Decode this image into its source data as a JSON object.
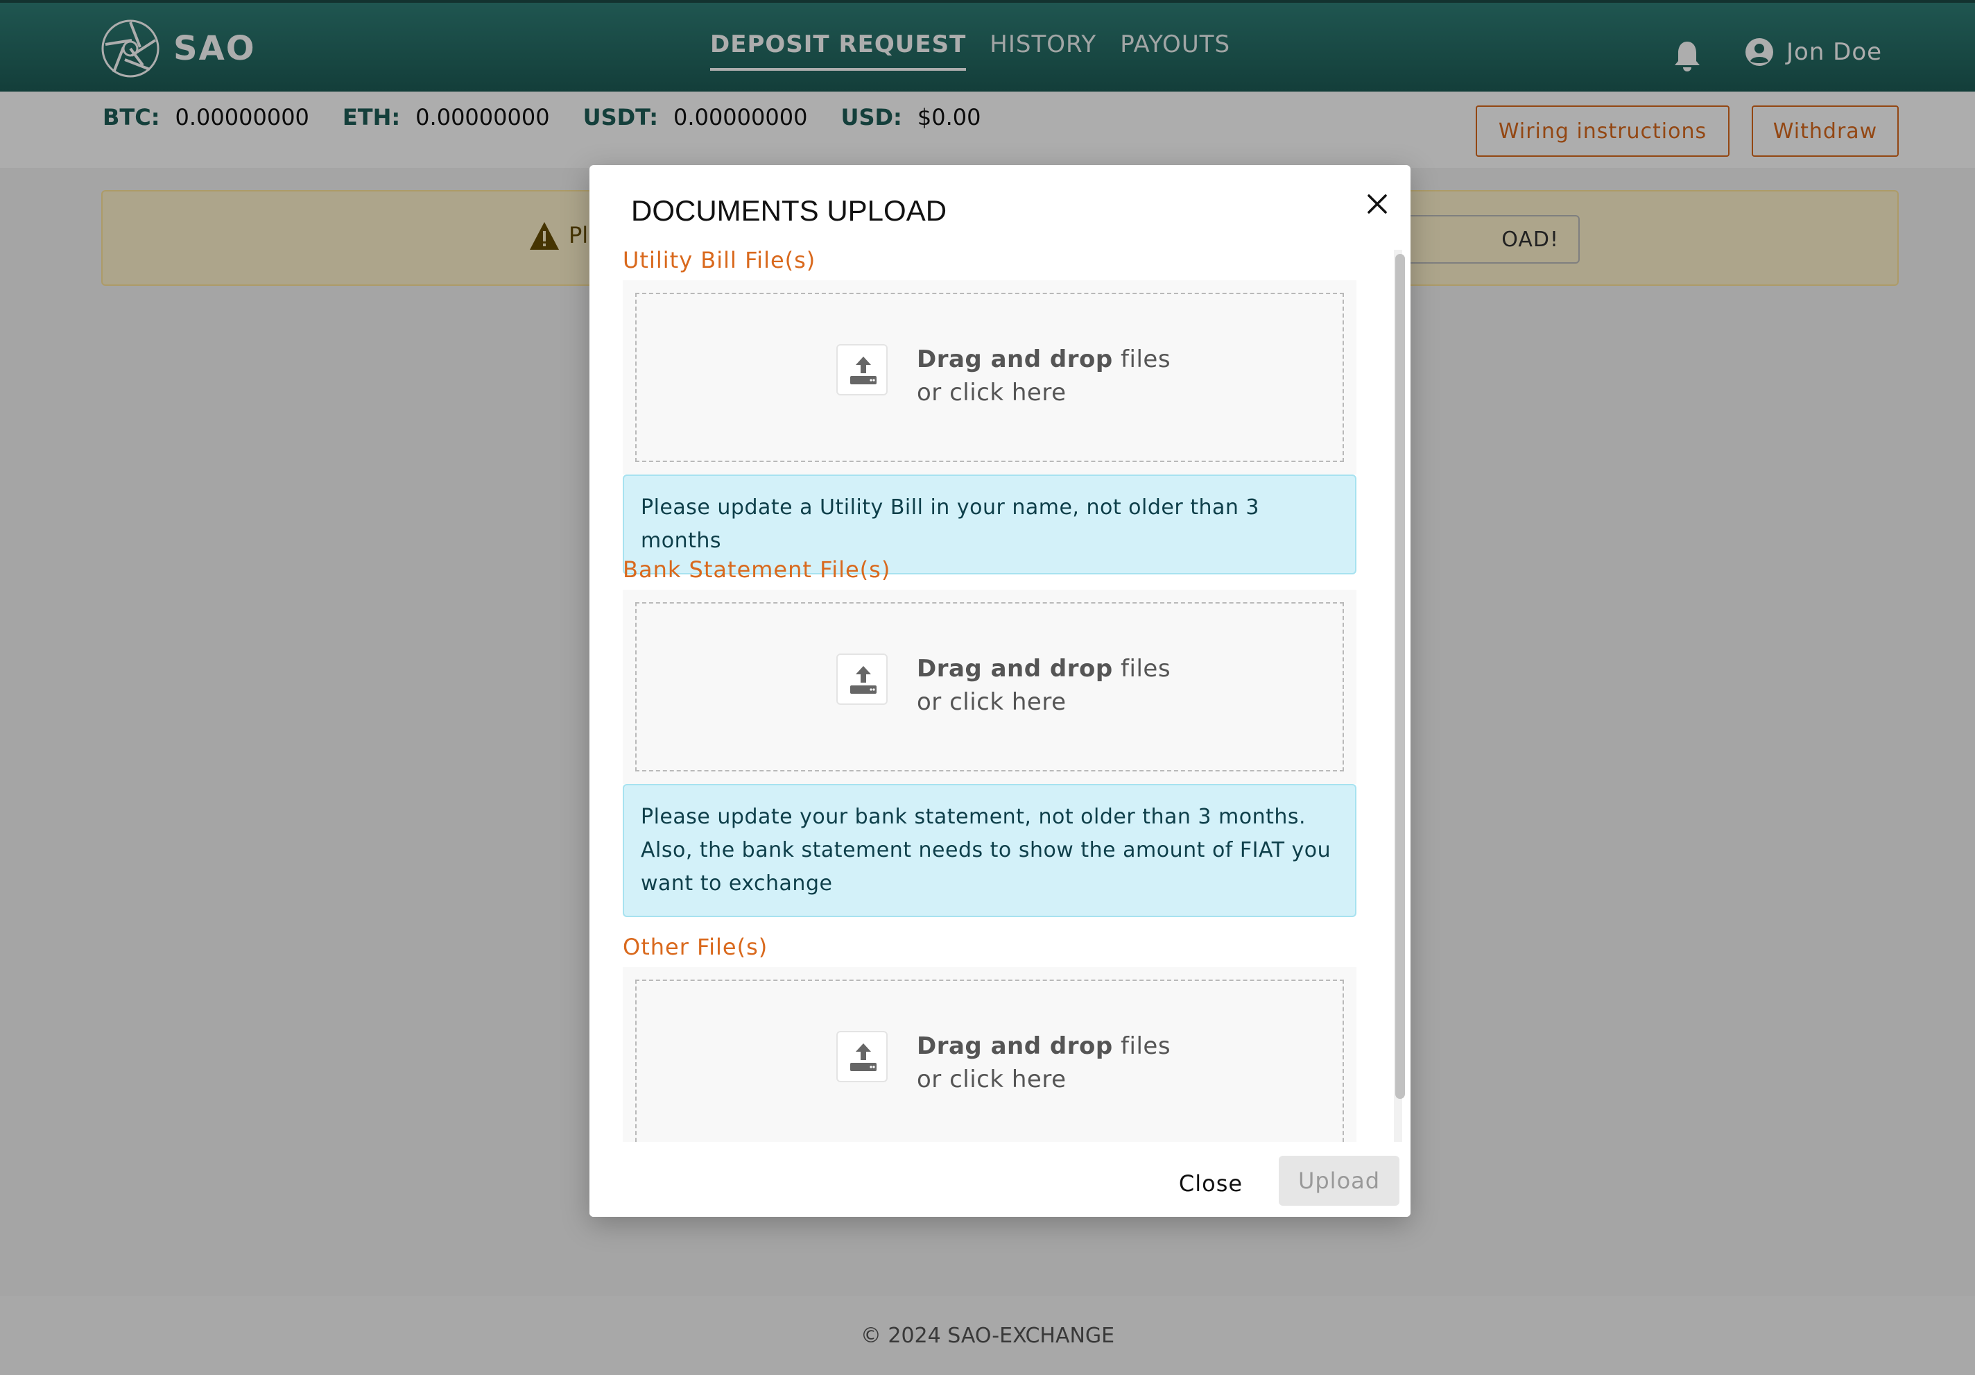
{
  "header": {
    "brand": "SAO",
    "nav": [
      {
        "label": "DEPOSIT REQUEST",
        "active": true
      },
      {
        "label": "HISTORY",
        "active": false
      },
      {
        "label": "PAYOUTS",
        "active": false
      }
    ],
    "user_name": "Jon Doe",
    "icons": {
      "logo": "aperture-logo-icon",
      "notifications": "bell-icon",
      "user": "user-circle-icon"
    }
  },
  "balances": [
    {
      "label": "BTC:",
      "value": "0.00000000"
    },
    {
      "label": "ETH:",
      "value": "0.00000000"
    },
    {
      "label": "USDT:",
      "value": "0.00000000"
    },
    {
      "label": "USD:",
      "value": "$0.00"
    }
  ],
  "actions": {
    "wiring_label": "Wiring instructions",
    "withdraw_label": "Withdraw"
  },
  "alert": {
    "text_visible": "Pl",
    "button_visible": "OAD!",
    "icon": "warning-triangle-icon"
  },
  "modal": {
    "title": "DOCUMENTS UPLOAD",
    "sections": [
      {
        "label": "Utility Bill File(s)",
        "dropzone": {
          "bold": "Drag and drop",
          "rest": " files",
          "line2": "or click here"
        },
        "info": "Please update a Utility Bill in your name, not older than 3 months"
      },
      {
        "label": "Bank Statement File(s)",
        "dropzone": {
          "bold": "Drag and drop",
          "rest": " files",
          "line2": "or click here"
        },
        "info": "Please update your bank statement, not older than 3 months. Also, the bank statement needs to show the amount of FIAT you want to exchange"
      },
      {
        "label": "Other File(s)",
        "dropzone": {
          "bold": "Drag and drop",
          "rest": " files",
          "line2": "or click here"
        }
      }
    ],
    "close_label": "Close",
    "upload_label": "Upload"
  },
  "footer": {
    "text": "© 2024 SAO-EXCHANGE"
  },
  "colors": {
    "header_teal": "#1d5c56",
    "accent_orange": "#d9691d",
    "info_bg": "#d3f1f9",
    "alert_bg": "#fff3cd"
  }
}
